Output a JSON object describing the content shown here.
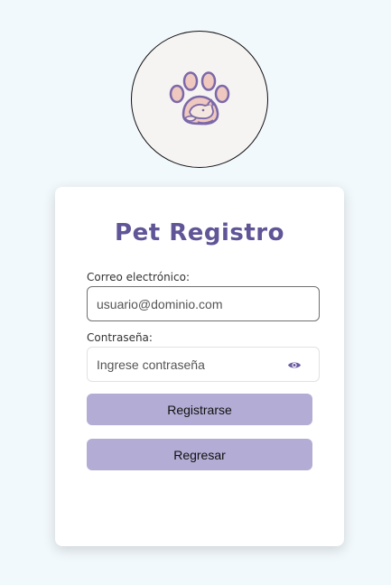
{
  "app": {
    "title": "Pet Registro"
  },
  "form": {
    "email_label": "Correo electrónico:",
    "email_value": "usuario@dominio.com",
    "password_label": "Contraseña:",
    "password_placeholder": "Ingrese contraseña",
    "register_label": "Registrarse",
    "back_label": "Regresar"
  },
  "icons": {
    "logo": "paw-pet-icon",
    "password_toggle": "eye-icon"
  },
  "colors": {
    "page_background": "#f2f9fd",
    "title": "#5f5597",
    "button": "#b3acd4",
    "icon_purple": "#6a5aa0"
  }
}
